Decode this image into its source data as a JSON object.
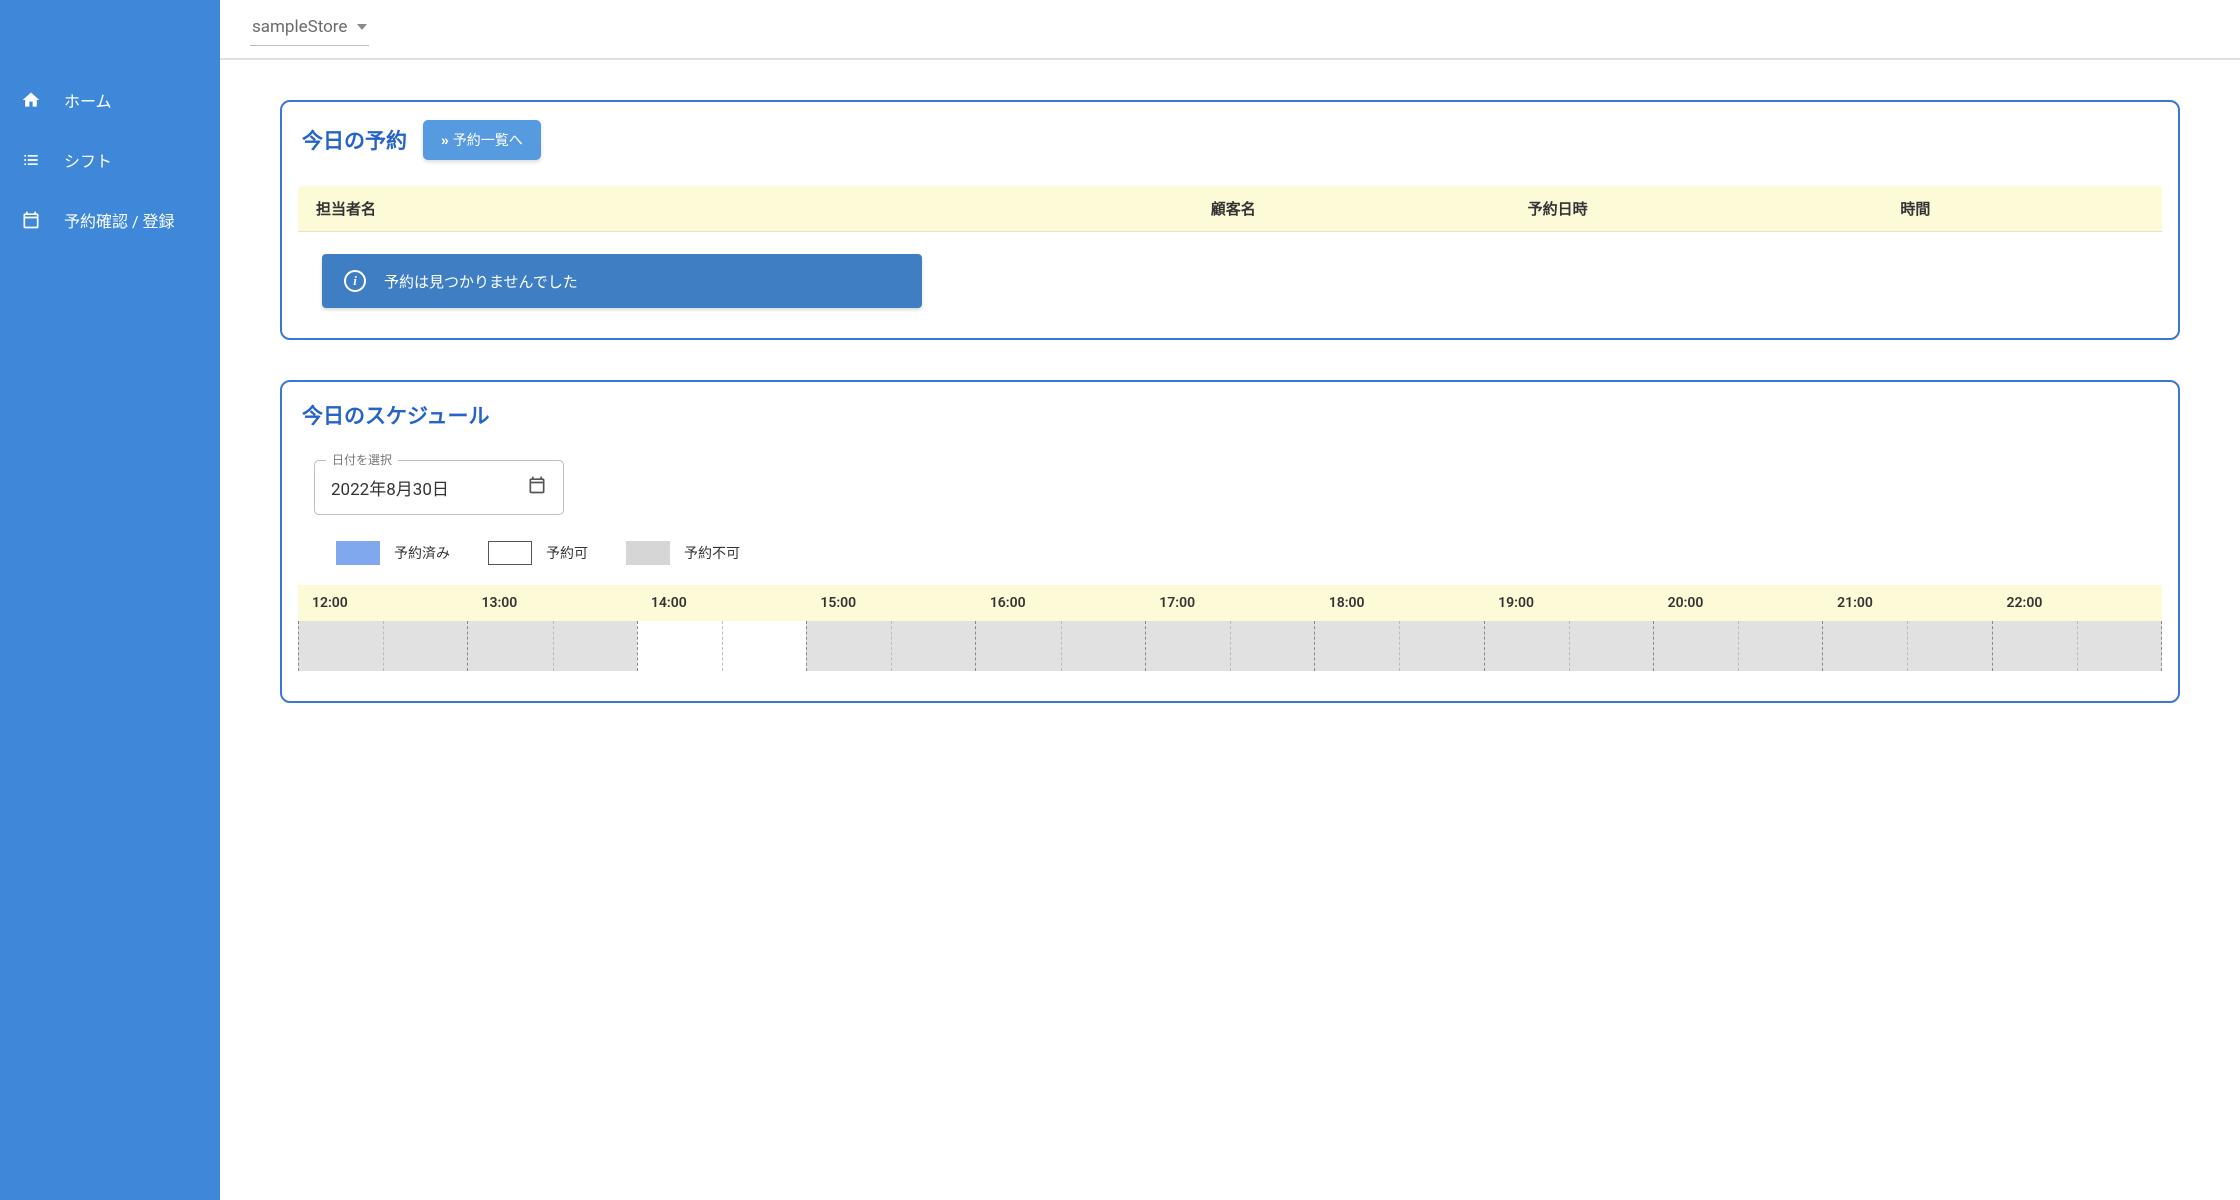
{
  "store_selector": {
    "value": "sampleStore"
  },
  "sidebar": {
    "items": [
      {
        "label": "ホーム"
      },
      {
        "label": "シフト"
      },
      {
        "label": "予約確認 / 登録"
      }
    ]
  },
  "reservations": {
    "title": "今日の予約",
    "list_button": "予約一覧へ",
    "columns": {
      "staff": "担当者名",
      "customer": "顧客名",
      "datetime": "予約日時",
      "duration": "時間"
    },
    "empty_message": "予約は見つかりませんでした"
  },
  "schedule": {
    "title": "今日のスケジュール",
    "date_label": "日付を選択",
    "date_value": "2022年8月30日",
    "legend": {
      "booked": "予約済み",
      "available": "予約可",
      "unavailable": "予約不可"
    },
    "hours": [
      "12:00",
      "13:00",
      "14:00",
      "15:00",
      "16:00",
      "17:00",
      "18:00",
      "19:00",
      "20:00",
      "21:00",
      "22:00"
    ],
    "slots": [
      "na",
      "na",
      "avail",
      "na",
      "na",
      "na",
      "na",
      "na",
      "na",
      "na",
      "na"
    ]
  }
}
